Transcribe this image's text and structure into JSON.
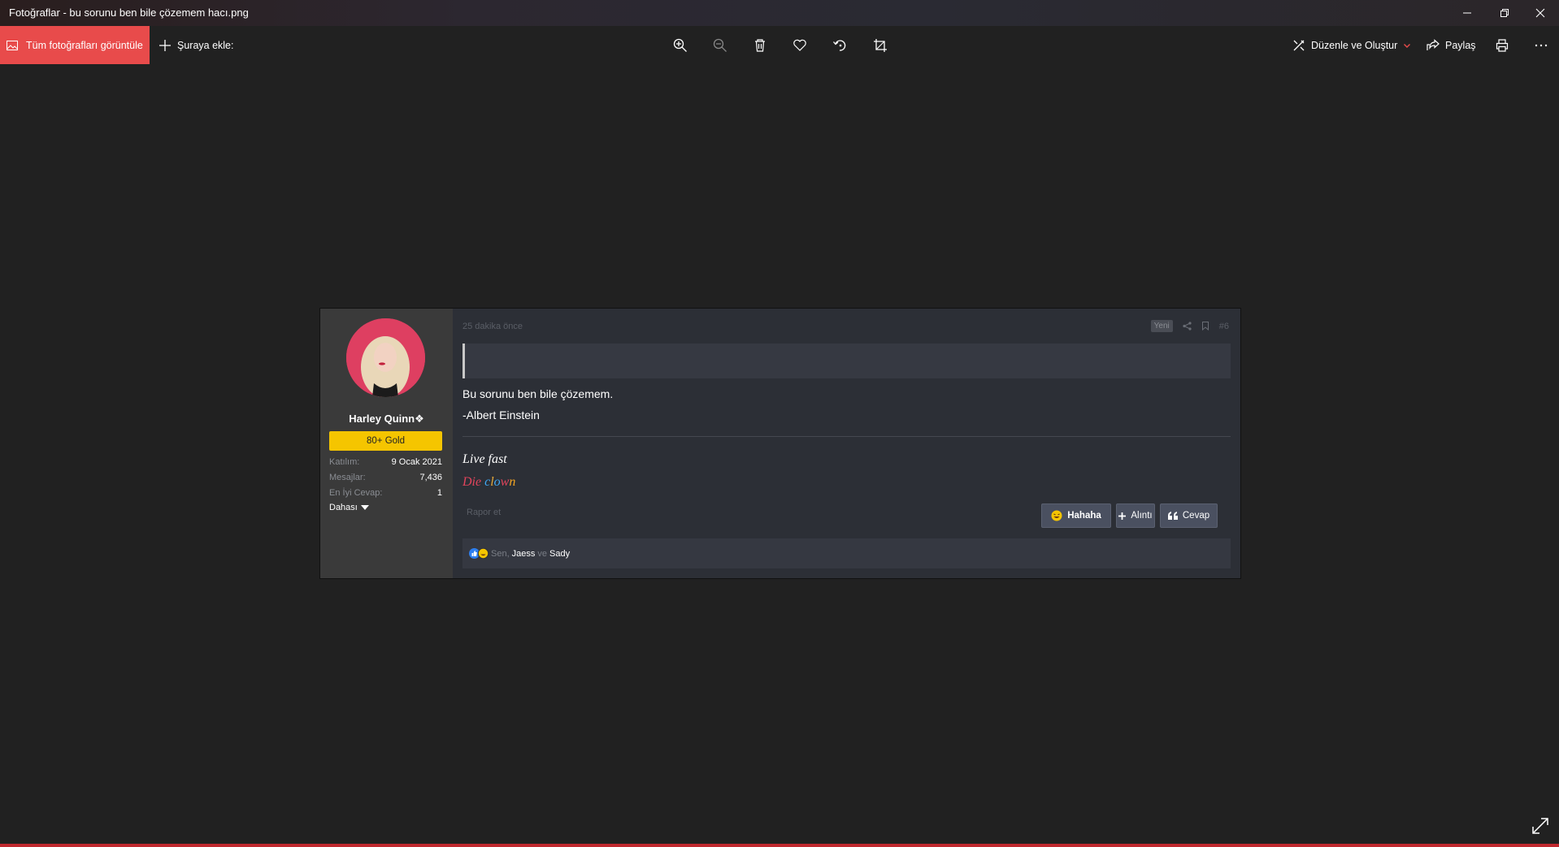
{
  "window": {
    "title": "Fotoğraflar - bu sorunu ben bile çözemem hacı.png"
  },
  "toolbar": {
    "view_all_label": "Tüm fotoğrafları görüntüle",
    "add_to_label": "Şuraya ekle:",
    "edit_create_label": "Düzenle ve Oluştur",
    "share_label": "Paylaş"
  },
  "post": {
    "user": {
      "name": "Harley Quinn❖",
      "rank": "80+ Gold",
      "stats": [
        {
          "key": "Katılım:",
          "value": "9 Ocak 2021"
        },
        {
          "key": "Mesajlar:",
          "value": "7,436"
        },
        {
          "key": "En İyi Cevap:",
          "value": "1"
        }
      ],
      "more_label": "Dahası"
    },
    "time": "25 dakika önce",
    "new_badge": "Yeni",
    "post_number": "#6",
    "body_line1": "Bu sorunu ben bile çözemem.",
    "body_line2": "-Albert Einstein",
    "signature_line1": "Live fast",
    "signature_die": "Die",
    "signature_clown": [
      "c",
      "l",
      "o",
      "w",
      "n"
    ],
    "report_label": "Rapor et",
    "buttons": {
      "hahaha": "Hahaha",
      "quote": "Alıntı",
      "reply": "Cevap"
    },
    "reactions": {
      "you": "Sen,",
      "user1": "Jaess",
      "and": "ve",
      "user2": "Sady"
    }
  },
  "colors": {
    "accent": "#e84b4b",
    "gold": "#f5c500",
    "die": "#e2445c",
    "clown": [
      "#3fa9f5",
      "#e4a83a",
      "#3fa9f5",
      "#e2445c",
      "#f5a623"
    ]
  }
}
